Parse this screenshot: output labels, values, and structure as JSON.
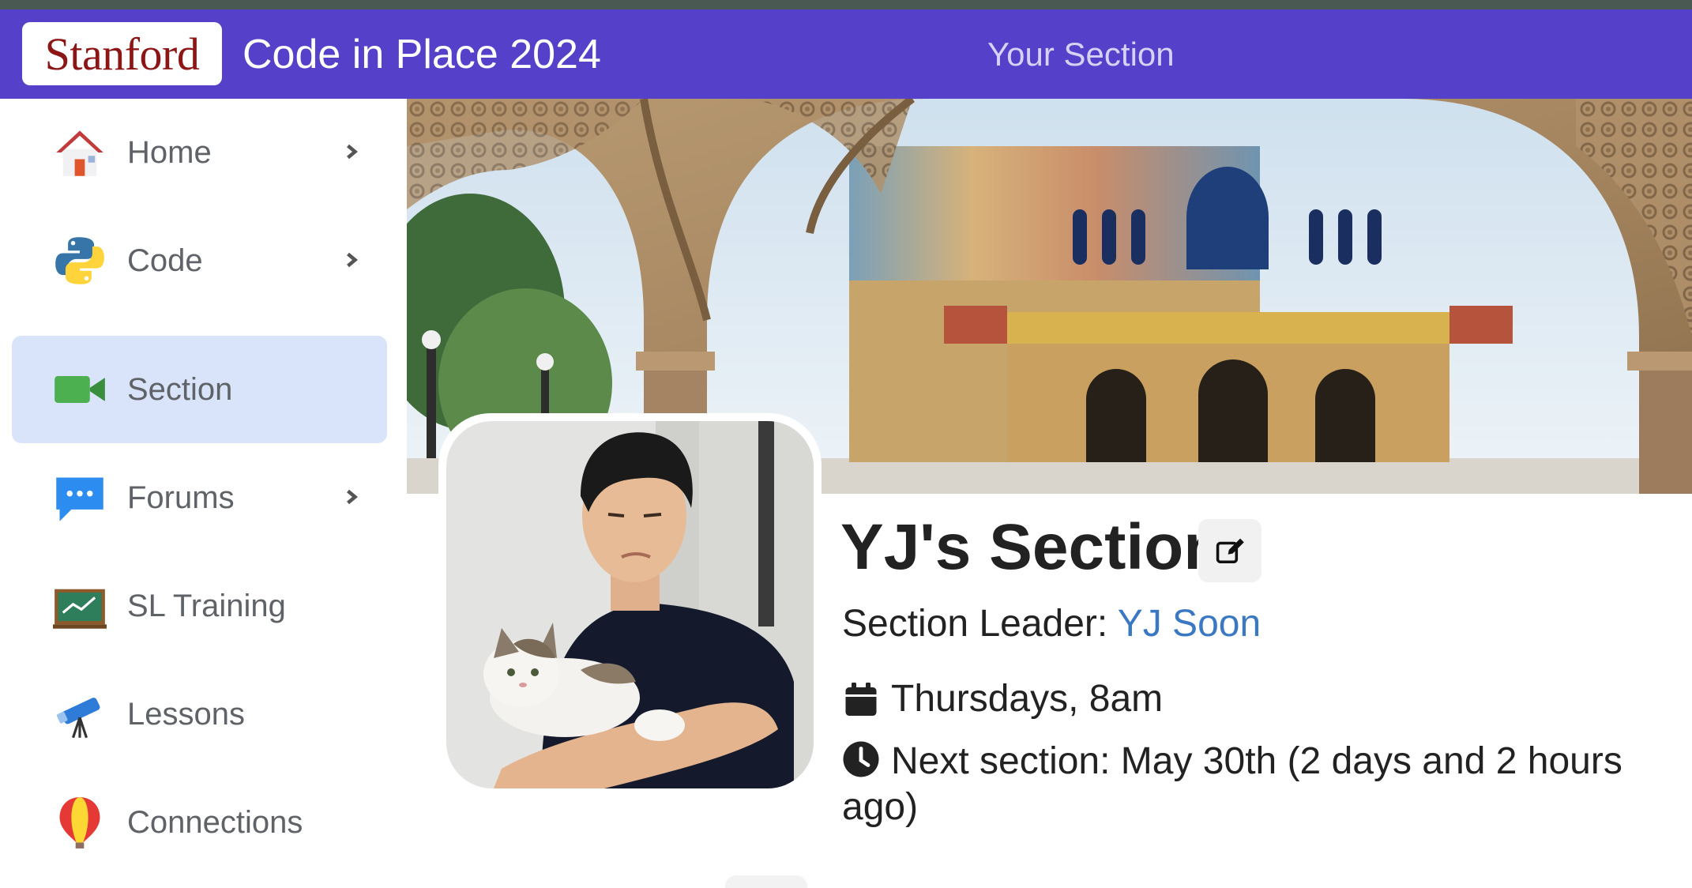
{
  "header": {
    "logo_text": "Stanford",
    "app_title": "Code in Place 2024",
    "nav_link": "Your Section",
    "colors": {
      "navbar": "#5540c9",
      "logo": "#8c1515"
    }
  },
  "sidebar": {
    "items": [
      {
        "label": "Home",
        "icon": "house-icon",
        "has_chevron": true,
        "active": false
      },
      {
        "label": "Code",
        "icon": "python-icon",
        "has_chevron": true,
        "active": false
      },
      {
        "label": "Section",
        "icon": "video-camera-icon",
        "has_chevron": false,
        "active": true
      },
      {
        "label": "Forums",
        "icon": "chat-bubble-icon",
        "has_chevron": true,
        "active": false
      },
      {
        "label": "SL Training",
        "icon": "chalkboard-icon",
        "has_chevron": false,
        "active": false
      },
      {
        "label": "Lessons",
        "icon": "telescope-icon",
        "has_chevron": false,
        "active": false
      },
      {
        "label": "Connections",
        "icon": "hot-air-balloon-icon",
        "has_chevron": false,
        "active": false
      }
    ],
    "active_color": "#d9e4fb"
  },
  "section": {
    "title": "YJ's Section",
    "leader_label": "Section Leader: ",
    "leader_name": "YJ Soon",
    "schedule": "Thursdays, 8am",
    "next_section": "Next section: May 30th (2 days and 2 hours ago)"
  }
}
